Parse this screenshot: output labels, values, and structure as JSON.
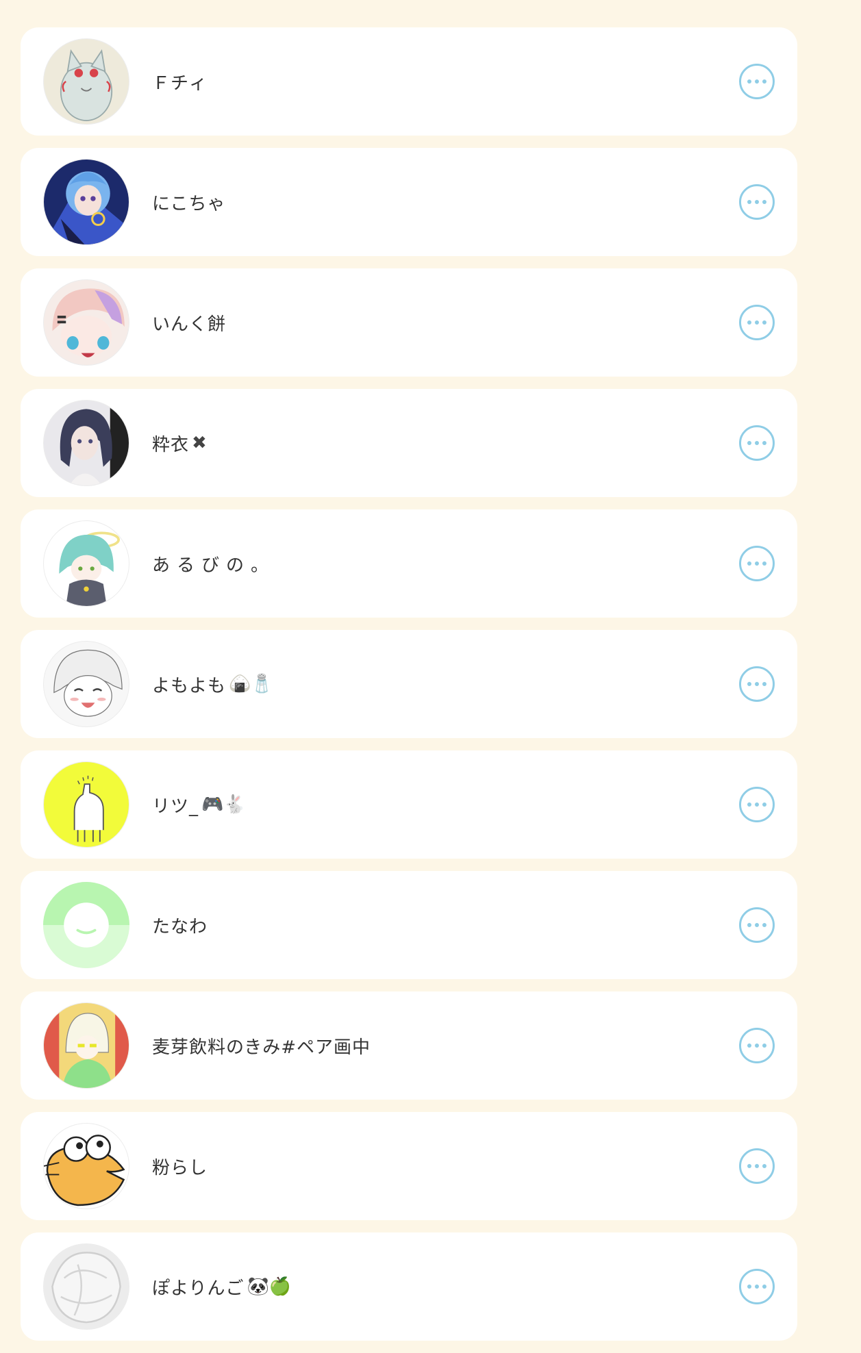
{
  "theme": {
    "page_bg": "#fdf6e6",
    "card_bg": "#ffffff",
    "name_color": "#333333",
    "more_button_color": "#8fcde6"
  },
  "friends": [
    {
      "name": "Ｆチィ",
      "deco": "",
      "avatar": "cat-avatar"
    },
    {
      "name": "にこちゃ",
      "deco": "",
      "avatar": "blue-hair-avatar"
    },
    {
      "name": "いんく餅",
      "deco": "",
      "avatar": "pink-hair-avatar"
    },
    {
      "name": "粋衣",
      "deco": "✖",
      "avatar": "dark-hair-avatar"
    },
    {
      "name": "あるびの。",
      "deco": "",
      "avatar": "teal-hair-avatar"
    },
    {
      "name": "よもよも",
      "deco": "🍙🧂",
      "avatar": "sketch-avatar"
    },
    {
      "name": "リツ_",
      "deco": "🎮🐇",
      "avatar": "yellow-llama-avatar"
    },
    {
      "name": "たなわ",
      "deco": "",
      "avatar": "green-smile-avatar"
    },
    {
      "name": "麦芽飲料のきみ#ペア画中",
      "deco": "",
      "avatar": "hoodie-avatar"
    },
    {
      "name": "粉らし",
      "deco": "",
      "avatar": "orange-bird-avatar"
    },
    {
      "name": "ぽよりんご",
      "deco": "🐼🍏",
      "avatar": "silver-avatar"
    }
  ]
}
